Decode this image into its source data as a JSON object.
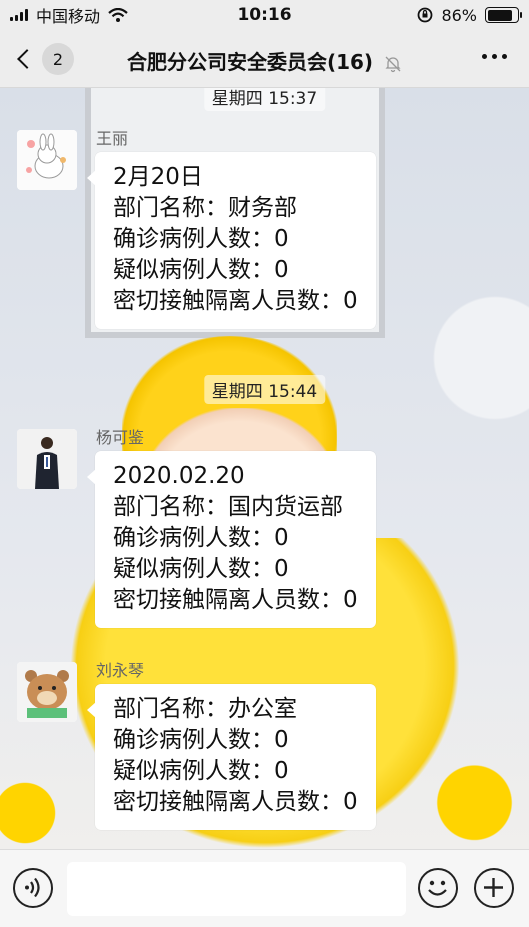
{
  "status_bar": {
    "carrier": "中国移动",
    "time": "10:16",
    "battery": "86%",
    "battery_level": 0.86
  },
  "header": {
    "back_badge": "2",
    "title": "合肥分公司安全委员会(16)"
  },
  "messages": [
    {
      "timestamp": "星期四 15:37",
      "sender": "王丽",
      "lines": [
        "2月20日",
        "部门名称：财务部",
        "确诊病例人数：0",
        "疑似病例人数：0",
        "密切接触隔离人员数：0"
      ]
    },
    {
      "timestamp": "星期四 15:44",
      "sender": "杨可鉴",
      "lines": [
        "2020.02.20",
        "部门名称：国内货运部",
        "确诊病例人数：0",
        "疑似病例人数：0",
        "密切接触隔离人员数：0"
      ]
    },
    {
      "sender": "刘永琴",
      "lines": [
        "部门名称：办公室",
        "确诊病例人数：0",
        "疑似病例人数：0",
        "密切接触隔离人员数：0"
      ]
    }
  ],
  "input_bar": {
    "placeholder": ""
  }
}
